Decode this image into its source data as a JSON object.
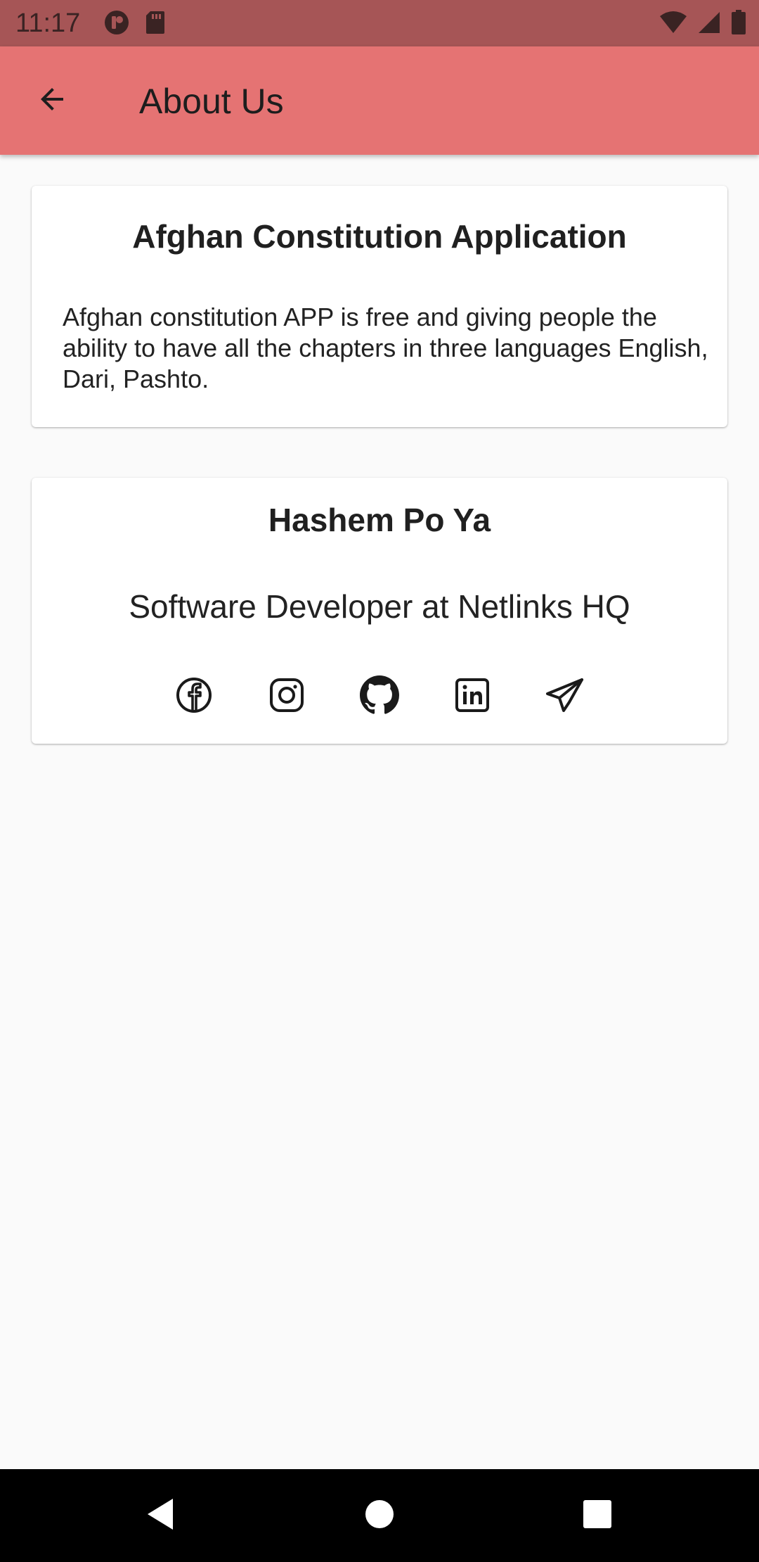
{
  "status_bar": {
    "time": "11:17",
    "left_icons": [
      "app-notification-icon",
      "sd-card-icon"
    ],
    "right_icons": [
      "wifi-icon",
      "cell-signal-icon",
      "battery-icon"
    ]
  },
  "app_bar": {
    "title": "About Us",
    "back_icon": "arrow-back-icon"
  },
  "about_card": {
    "title": "Afghan Constitution Application",
    "description": "Afghan constitution APP is free and giving people the ability to have all the chapters in three languages English, Dari, Pashto."
  },
  "developer_card": {
    "name": "Hashem Po Ya",
    "role": "Software Developer at Netlinks HQ",
    "social_links": [
      "facebook-icon",
      "instagram-icon",
      "github-icon",
      "linkedin-icon",
      "telegram-icon"
    ]
  },
  "nav_bar": {
    "buttons": [
      "back-triangle-icon",
      "home-circle-icon",
      "recents-square-icon"
    ]
  },
  "colors": {
    "status_bar": "#a65556",
    "app_bar": "#e57373",
    "background": "#fafafa",
    "card": "#ffffff",
    "nav_bar": "#000000"
  }
}
